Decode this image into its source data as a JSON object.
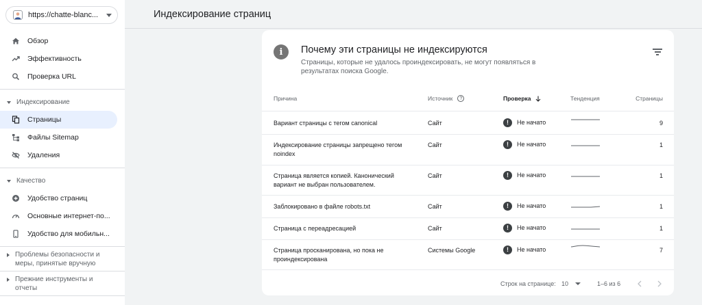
{
  "property": {
    "url": "https://chatte-blanc..."
  },
  "sidebar": {
    "top_items": [
      {
        "label": "Обзор",
        "icon": "home-icon"
      },
      {
        "label": "Эффективность",
        "icon": "trending-up-icon"
      },
      {
        "label": "Проверка URL",
        "icon": "search-icon"
      }
    ],
    "sections": [
      {
        "label": "Индексирование",
        "items": [
          {
            "label": "Страницы",
            "icon": "pages-icon",
            "active": true
          },
          {
            "label": "Файлы Sitemap",
            "icon": "sitemap-icon"
          },
          {
            "label": "Удаления",
            "icon": "eye-off-icon"
          }
        ]
      },
      {
        "label": "Качество",
        "items": [
          {
            "label": "Удобство страниц",
            "icon": "add-circle-icon"
          },
          {
            "label": "Основные интернет-по...",
            "icon": "speed-icon"
          },
          {
            "label": "Удобство для мобильн...",
            "icon": "phone-icon"
          }
        ]
      }
    ],
    "collapsed_sections": [
      "Проблемы безопасности и меры, принятые вручную",
      "Прежние инструменты и отчеты"
    ]
  },
  "header": {
    "title": "Индексирование страниц"
  },
  "card": {
    "title": "Почему эти страницы не индексируются",
    "description": "Страницы, которые не удалось проиндексировать, не могут появляться в результатах поиска Google.",
    "columns": {
      "reason": "Причина",
      "source": "Источник",
      "validation": "Проверка",
      "trend": "Тенденция",
      "pages": "Страницы"
    },
    "rows": [
      {
        "reason": "Вариант страницы с тегом canonical",
        "source": "Сайт",
        "status": "Не начато",
        "pages": "9"
      },
      {
        "reason": "Индексирование страницы запрещено тегом noindex",
        "source": "Сайт",
        "status": "Не начато",
        "pages": "1"
      },
      {
        "reason": "Страница является копией. Канонический вариант не выбран пользователем.",
        "source": "Сайт",
        "status": "Не начато",
        "pages": "1"
      },
      {
        "reason": "Заблокировано в файле robots.txt",
        "source": "Сайт",
        "status": "Не начато",
        "pages": "1"
      },
      {
        "reason": "Страница с переадресацией",
        "source": "Сайт",
        "status": "Не начато",
        "pages": "1"
      },
      {
        "reason": "Страница просканирована, но пока не проиндексирована",
        "source": "Системы Google",
        "status": "Не начато",
        "pages": "7"
      }
    ],
    "pagination": {
      "rows_per_page_label": "Строк на странице:",
      "rows_per_page": "10",
      "range": "1–6 из 6"
    }
  },
  "colors": {
    "accent_bg": "#e8f0fe",
    "status_icon": "#3c4043",
    "text_secondary": "#5f6368"
  }
}
